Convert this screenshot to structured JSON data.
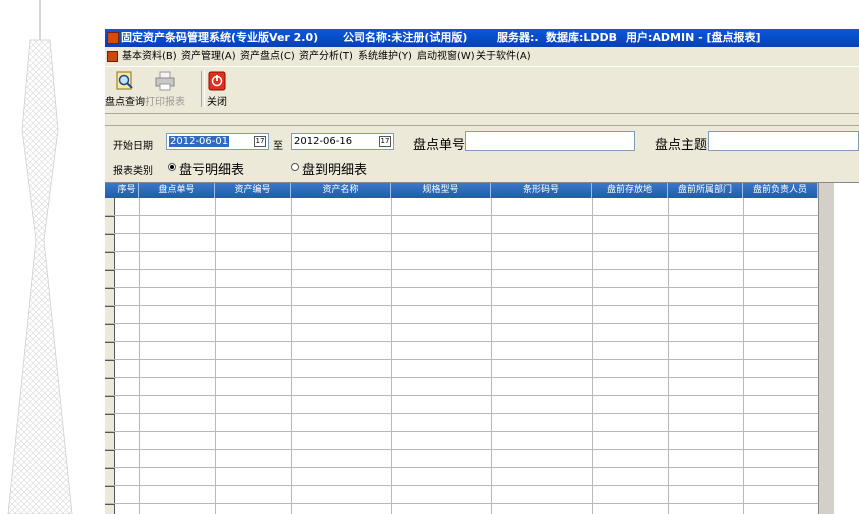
{
  "window": {
    "title_app": "固定资产条码管理系统(专业版Ver 2.0)",
    "title_company": "公司名称:未注册(试用版)",
    "title_server": "服务器:.",
    "title_db": "数据库:LDDB",
    "title_user": "用户:ADMIN - [盘点报表]"
  },
  "menu": [
    "基本资料(B)",
    "资产管理(A)",
    "资产盘点(C)",
    "资产分析(T)",
    "系统维护(Y)",
    "启动视窗(W)",
    "关于软件(A)"
  ],
  "toolbar": {
    "query_label": "盘点查询",
    "print_label": "打印报表",
    "close_label": "关闭"
  },
  "filter": {
    "start_date_label": "开始日期",
    "start_date": "2012-06-01",
    "to_label": "至",
    "end_date": "2012-06-16",
    "inventory_no_label": "盘点单号",
    "inventory_no": "",
    "subject_label": "盘点主题",
    "subject": "",
    "report_type_label": "报表类别",
    "option_loss": "盘亏明细表",
    "option_found": "盘到明细表",
    "selected": "盘亏明细表"
  },
  "grid": {
    "columns": [
      "序号",
      "盘点单号",
      "资产编号",
      "资产名称",
      "规格型号",
      "条形码号",
      "盘前存放地",
      "盘前所属部门",
      "盘前负责人员"
    ],
    "rows": []
  },
  "colors": {
    "titlebar": "#0a58d8",
    "grid_header": "#2a68b8",
    "window_bg": "#ece9d8",
    "close_icon": "#e03020"
  },
  "icons": {
    "query": "magnifier-document-icon",
    "print": "printer-icon",
    "close": "power-close-icon"
  }
}
